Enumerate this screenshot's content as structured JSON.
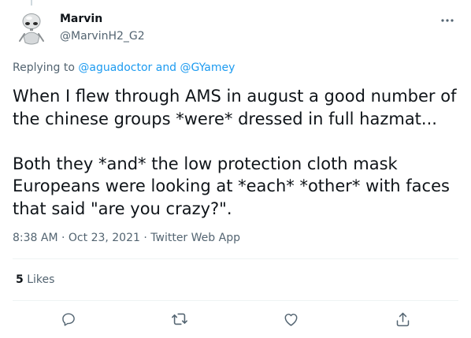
{
  "author": {
    "name": "Marvin",
    "handle": "@MarvinH2_G2",
    "avatar_icon": "robot-avatar"
  },
  "more_icon": "more-horizontal-icon",
  "reply_context": {
    "prefix": "Replying to",
    "mention_1": "@aguadoctor",
    "conjunction": "and",
    "mention_2": "@GYamey"
  },
  "body": {
    "paragraph_1": "When I flew through AMS in august a good number of the chinese groups *were* dressed in full hazmat...",
    "paragraph_2": "Both they *and* the low protection cloth mask Europeans were looking at *each* *other* with faces that said \"are you crazy?\"."
  },
  "meta": {
    "time": "8:38 AM",
    "separator_1": "·",
    "date": "Oct 23, 2021",
    "separator_2": "·",
    "source": "Twitter Web App"
  },
  "stats": {
    "likes_count": "5",
    "likes_label": "Likes"
  },
  "actions": [
    {
      "icon": "reply-icon"
    },
    {
      "icon": "retweet-icon"
    },
    {
      "icon": "like-icon"
    },
    {
      "icon": "share-icon"
    }
  ],
  "colors": {
    "text": "#0f1419",
    "secondary": "#536471",
    "link": "#1d9bf0",
    "divider": "#eff3f4"
  }
}
